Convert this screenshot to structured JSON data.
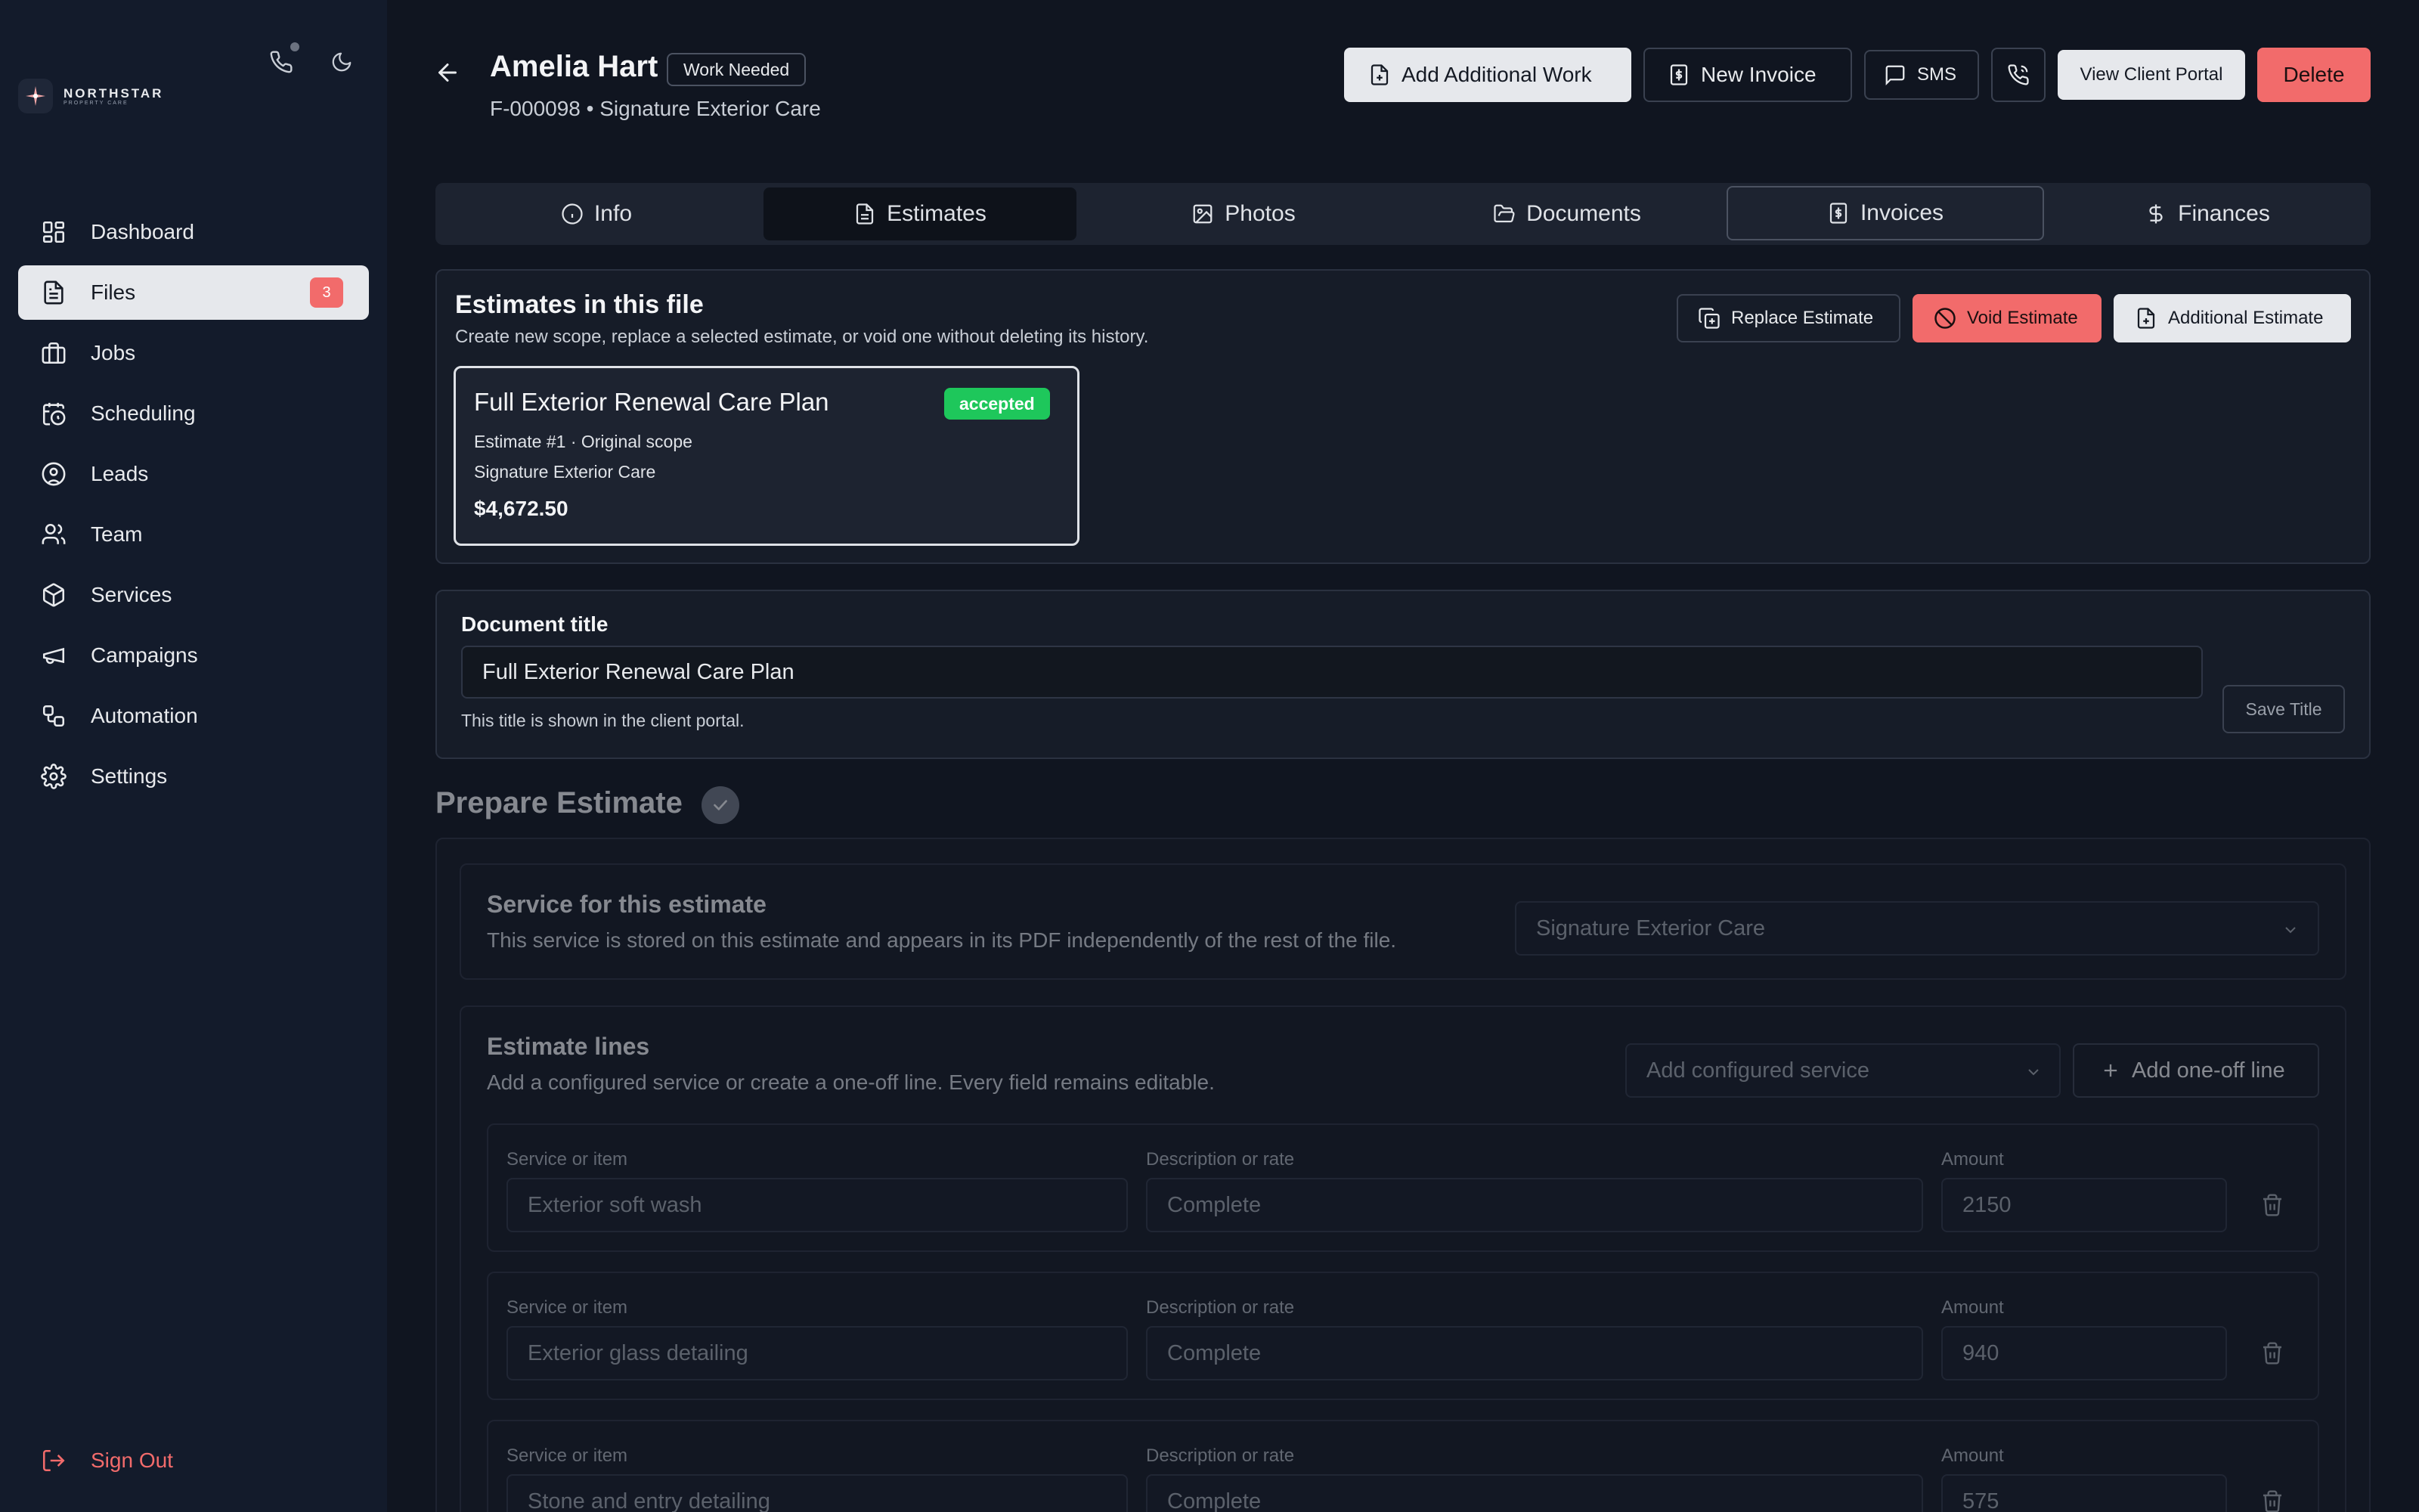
{
  "brand": {
    "name": "NORTHSTAR",
    "tagline": "PROPERTY CARE"
  },
  "sidebar": {
    "items": [
      {
        "label": "Dashboard",
        "icon": "dashboard-icon"
      },
      {
        "label": "Files",
        "icon": "file-icon",
        "badge": "3",
        "active": true
      },
      {
        "label": "Jobs",
        "icon": "briefcase-icon"
      },
      {
        "label": "Scheduling",
        "icon": "calendar-clock-icon"
      },
      {
        "label": "Leads",
        "icon": "user-circle-icon"
      },
      {
        "label": "Team",
        "icon": "users-icon"
      },
      {
        "label": "Services",
        "icon": "package-icon"
      },
      {
        "label": "Campaigns",
        "icon": "megaphone-icon"
      },
      {
        "label": "Automation",
        "icon": "workflow-icon"
      },
      {
        "label": "Settings",
        "icon": "gear-icon"
      }
    ],
    "sign_out": "Sign Out"
  },
  "header": {
    "client_name": "Amelia Hart",
    "status": "Work Needed",
    "file_number": "F-000098",
    "service": "Signature Exterior Care",
    "subtitle": "F-000098 • Signature Exterior Care",
    "buttons": {
      "add_work": "Add Additional Work",
      "new_invoice": "New Invoice",
      "sms": "SMS",
      "client_portal": "View Client Portal",
      "delete": "Delete"
    }
  },
  "tabs": [
    {
      "label": "Info",
      "icon": "info-icon"
    },
    {
      "label": "Estimates",
      "icon": "document-icon",
      "active": true
    },
    {
      "label": "Photos",
      "icon": "image-icon"
    },
    {
      "label": "Documents",
      "icon": "folder-icon"
    },
    {
      "label": "Invoices",
      "icon": "receipt-icon"
    },
    {
      "label": "Finances",
      "icon": "dollar-icon"
    }
  ],
  "estimates_panel": {
    "title": "Estimates in this file",
    "subtitle": "Create new scope, replace a selected estimate, or void one without deleting its history.",
    "buttons": {
      "replace": "Replace Estimate",
      "void": "Void Estimate",
      "additional": "Additional Estimate"
    },
    "estimate": {
      "title": "Full Exterior Renewal Care Plan",
      "status": "accepted",
      "meta": "Estimate #1 · Original scope",
      "service": "Signature Exterior Care",
      "total": "$4,672.50"
    }
  },
  "document_title": {
    "label": "Document title",
    "value": "Full Exterior Renewal Care Plan",
    "hint": "This title is shown in the client portal.",
    "save_label": "Save Title"
  },
  "prepare": {
    "title": "Prepare Estimate",
    "service_section": {
      "title": "Service for this estimate",
      "subtitle": "This service is stored on this estimate and appears in its PDF independently of the rest of the file.",
      "selected": "Signature Exterior Care"
    },
    "lines_section": {
      "title": "Estimate lines",
      "subtitle": "Add a configured service or create a one-off line. Every field remains editable.",
      "add_configured": "Add configured service",
      "add_one_off": "Add one-off line",
      "col_service": "Service or item",
      "col_desc": "Description or rate",
      "col_amount": "Amount",
      "lines": [
        {
          "service": "Exterior soft wash",
          "description": "Complete",
          "amount": "2150"
        },
        {
          "service": "Exterior glass detailing",
          "description": "Complete",
          "amount": "940"
        },
        {
          "service": "Stone and entry detailing",
          "description": "Complete",
          "amount": "575"
        }
      ]
    }
  },
  "colors": {
    "accent_red": "#f26b6b",
    "accent_green": "#1ec75b",
    "bg": "#101520",
    "sidebar": "#131b2b"
  }
}
